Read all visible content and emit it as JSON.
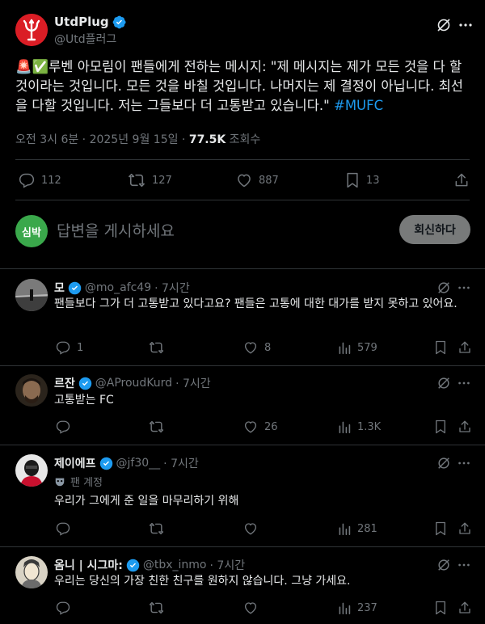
{
  "author": {
    "name": "UtdPlug",
    "handle": "@Utd플러그"
  },
  "post": {
    "emoji": "🚨✅",
    "text_before": "루벤 아모림이 팬들에게 전하는 메시지: \"제 메시지는 제가 모든 것을 다 할 것이라는 것입니다. 모든 것을 바칠 것입니다. 나머지는 제 결정이 아닙니다. 최선을 다할 것입니다. 저는 그들보다 더 고통받고 있습니다.\" ",
    "hashtag": "#MUFC",
    "timestamp": "오전 3시 6분 · 2025년 9월 15일 · ",
    "views": "77.5K",
    "views_label": " 조회수"
  },
  "post_stats": {
    "replies": "112",
    "reposts": "127",
    "likes": "887",
    "bookmarks": "13"
  },
  "composer": {
    "avatar_label": "심박",
    "placeholder": "답변을 게시하세요",
    "button": "회신하다",
    "avatar_color": "#3aa84b"
  },
  "replies": [
    {
      "name": "모",
      "handle": "@mo_afc49",
      "time": "· 7시간",
      "text": "팬들보다 그가 더 고통받고 있다고요? 팬들은 고통에 대한 대가를 받지 못하고 있어요.",
      "replies": "1",
      "reposts": "",
      "likes": "8",
      "views": "579"
    },
    {
      "name": "르잔",
      "handle": "@AProudKurd",
      "time": "· 7시간",
      "text": "고통받는 FC",
      "replies": "",
      "reposts": "",
      "likes": "26",
      "views": "1.3K"
    },
    {
      "name": "제이에프",
      "handle": "@jf30__",
      "time": "· 7시간",
      "badge": "팬 계정",
      "text": "우리가 그에게 준 일을 마무리하기 위해",
      "replies": "",
      "reposts": "",
      "likes": "",
      "views": "281"
    },
    {
      "name": "옴니 | 시그마:",
      "handle": "@tbx_inmo",
      "time": "· 7시간",
      "text": "우리는 당신의 가장 친한 친구를 원하지 않습니다. 그냥 가세요.",
      "replies": "",
      "reposts": "",
      "likes": "",
      "views": "237"
    }
  ],
  "icons": {
    "verified": "verified-badge-icon",
    "grok": "grok-icon",
    "more": "more-icon",
    "reply": "reply-icon",
    "repost": "repost-icon",
    "like": "like-icon",
    "views": "views-icon",
    "bookmark": "bookmark-icon",
    "share": "share-icon"
  },
  "colors": {
    "accent": "#1d9bf0",
    "background": "#000000",
    "text": "#e7e9ea",
    "muted": "#71767b",
    "divider": "#2f3336",
    "logo_red": "#da1d25"
  }
}
